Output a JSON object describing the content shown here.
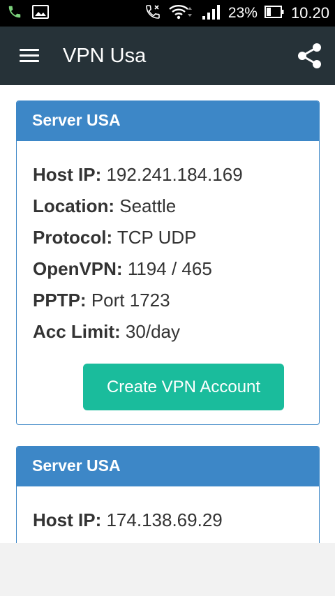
{
  "status_bar": {
    "icons_left": [
      "phone-icon",
      "gallery-icon"
    ],
    "icons_right": [
      "call-forward-icon",
      "wifi-icon",
      "signal-icon",
      "battery-icon"
    ],
    "battery": "23%",
    "time": "10.20"
  },
  "app_bar": {
    "title": "VPN Usa",
    "menu_icon": "hamburger-menu-icon",
    "share_icon": "share-icon"
  },
  "colors": {
    "app_bar": "#263238",
    "card_header": "#3d87c7",
    "button": "#1abc9c",
    "text": "#333333"
  },
  "servers": [
    {
      "title": "Server USA",
      "host_label": "Host IP:",
      "host_value": "192.241.184.169",
      "location_label": "Location:",
      "location_value": "Seattle",
      "protocol_label": "Protocol:",
      "protocol_value": "TCP UDP",
      "openvpn_label": "OpenVPN:",
      "openvpn_value": "1194 / 465",
      "pptp_label": "PPTP:",
      "pptp_value": "Port 1723",
      "limit_label": "Acc Limit:",
      "limit_value": "30/day",
      "button_label": "Create VPN Account"
    },
    {
      "title": "Server USA",
      "host_label": "Host IP:",
      "host_value": "174.138.69.29"
    }
  ]
}
